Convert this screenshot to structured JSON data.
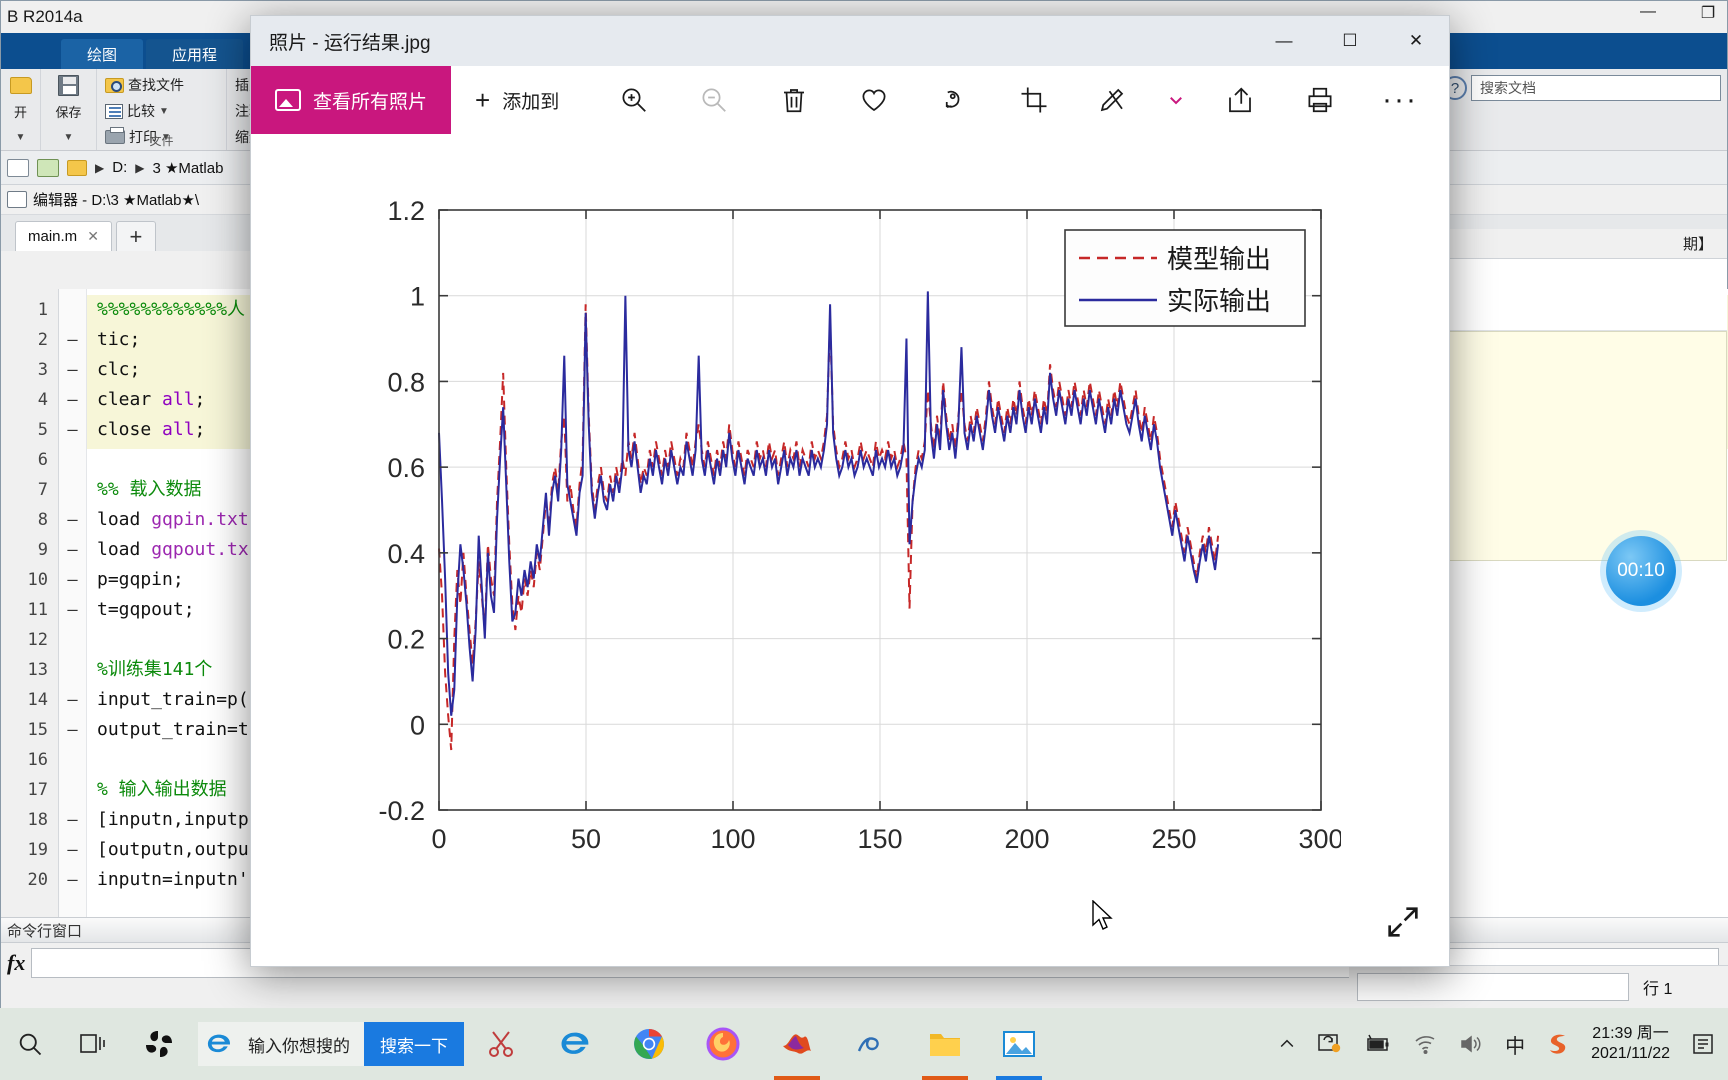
{
  "matlab": {
    "window_title": "B R2014a",
    "window_controls": [
      "—",
      "❐"
    ],
    "ribbon_tabs": [
      {
        "label": "绘图"
      },
      {
        "label": "应用程"
      }
    ],
    "ribbon": {
      "file_group_label": "文件",
      "open_label": "开",
      "save_label": "保存",
      "find_file_label": "查找文件",
      "compare_label": "比较",
      "print_label": "打印",
      "insert_label": "插入",
      "comment_label": "注释",
      "indent_label": "缩进",
      "help_search_placeholder": "搜索文档"
    },
    "address_bar": {
      "drive": "D:",
      "folder": "3 ★Matlab"
    },
    "editor_bar_label": "编辑器 - D:\\3 ★Matlab★\\",
    "tabs": [
      {
        "label": "main.m",
        "close": "✕"
      }
    ],
    "tab_add": "+",
    "code_lines": [
      {
        "n": "1",
        "mark": "",
        "parts": [
          {
            "t": "%%%%%%%%%%%%人",
            "c": "cm"
          }
        ]
      },
      {
        "n": "2",
        "mark": "—",
        "parts": [
          {
            "t": "tic;",
            "c": ""
          }
        ]
      },
      {
        "n": "3",
        "mark": "—",
        "parts": [
          {
            "t": "clc;",
            "c": ""
          }
        ]
      },
      {
        "n": "4",
        "mark": "—",
        "parts": [
          {
            "t": "clear ",
            "c": ""
          },
          {
            "t": "all",
            "c": "kw"
          },
          {
            "t": ";",
            "c": ""
          }
        ]
      },
      {
        "n": "5",
        "mark": "—",
        "parts": [
          {
            "t": "close ",
            "c": ""
          },
          {
            "t": "all",
            "c": "kw"
          },
          {
            "t": ";",
            "c": ""
          }
        ]
      },
      {
        "n": "6",
        "mark": "",
        "parts": []
      },
      {
        "n": "7",
        "mark": "",
        "parts": [
          {
            "t": "%% 载入数据",
            "c": "cm"
          }
        ]
      },
      {
        "n": "8",
        "mark": "—",
        "parts": [
          {
            "t": "load ",
            "c": ""
          },
          {
            "t": "gqpin.txt",
            "c": "st"
          }
        ]
      },
      {
        "n": "9",
        "mark": "—",
        "parts": [
          {
            "t": "load ",
            "c": ""
          },
          {
            "t": "gqpout.tx",
            "c": "st"
          }
        ]
      },
      {
        "n": "10",
        "mark": "—",
        "parts": [
          {
            "t": "p=gqpin;",
            "c": ""
          }
        ]
      },
      {
        "n": "11",
        "mark": "—",
        "parts": [
          {
            "t": "t=gqpout;",
            "c": ""
          }
        ]
      },
      {
        "n": "12",
        "mark": "",
        "parts": []
      },
      {
        "n": "13",
        "mark": "",
        "parts": [
          {
            "t": "%训练集141个",
            "c": "cm"
          }
        ]
      },
      {
        "n": "14",
        "mark": "—",
        "parts": [
          {
            "t": "input_train=p(",
            "c": ""
          }
        ]
      },
      {
        "n": "15",
        "mark": "—",
        "parts": [
          {
            "t": "output_train=t",
            "c": ""
          }
        ]
      },
      {
        "n": "16",
        "mark": "",
        "parts": []
      },
      {
        "n": "17",
        "mark": "",
        "parts": [
          {
            "t": "% 输入输出数据",
            "c": "cm"
          }
        ]
      },
      {
        "n": "18",
        "mark": "—",
        "parts": [
          {
            "t": "[inputn,inputp",
            "c": ""
          }
        ]
      },
      {
        "n": "19",
        "mark": "—",
        "parts": [
          {
            "t": "[outputn,outpu",
            "c": ""
          }
        ]
      },
      {
        "n": "20",
        "mark": "—",
        "parts": [
          {
            "t": "inputn=inputn'",
            "c": ""
          }
        ]
      }
    ],
    "command_window_title": "命令行窗口",
    "right_panel_header": "期】",
    "timer_value": "00:10",
    "status_row_label": "行  1"
  },
  "photos": {
    "title": "照片 - 运行结果.jpg",
    "window_controls": {
      "minimize": "—",
      "maximize": "☐",
      "close": "✕"
    },
    "view_all_label": "查看所有照片",
    "add_to_label": "添加到",
    "tool_icons": [
      {
        "name": "zoom-in-icon"
      },
      {
        "name": "zoom-out-icon"
      },
      {
        "name": "delete-icon"
      },
      {
        "name": "favorite-icon"
      },
      {
        "name": "rotate-icon"
      },
      {
        "name": "crop-icon"
      }
    ],
    "right_icons": [
      {
        "name": "edit-create-icon"
      },
      {
        "name": "chevron-down-icon"
      },
      {
        "name": "share-icon"
      },
      {
        "name": "print-icon"
      },
      {
        "name": "more-icon"
      }
    ],
    "more_label": "···"
  },
  "chart_data": {
    "type": "line",
    "title": "",
    "xlabel": "",
    "ylabel": "",
    "xlim": [
      0,
      300
    ],
    "ylim": [
      -0.2,
      1.2
    ],
    "xticks": [
      0,
      50,
      100,
      150,
      200,
      250,
      300
    ],
    "yticks": [
      -0.2,
      0,
      0.2,
      0.4,
      0.6,
      0.8,
      1,
      1.2
    ],
    "ytick_labels": [
      "-0.2",
      "0",
      "0.2",
      "0.4",
      "0.6",
      "0.8",
      "1",
      "1.2"
    ],
    "xtick_labels": [
      "0",
      "50",
      "100",
      "150",
      "200",
      "250",
      "300"
    ],
    "grid": true,
    "legend_position": "upper right",
    "colors": {
      "model": "#c62828",
      "actual": "#2b2b9e"
    },
    "series": [
      {
        "name": "模型输出",
        "style": "dashed",
        "color": "#c62828",
        "values": [
          0.41,
          0.3,
          0.12,
          0.02,
          -0.06,
          0.2,
          0.36,
          0.28,
          0.4,
          0.3,
          0.22,
          0.14,
          0.24,
          0.38,
          0.3,
          0.22,
          0.42,
          0.34,
          0.3,
          0.52,
          0.66,
          0.82,
          0.6,
          0.42,
          0.28,
          0.22,
          0.3,
          0.26,
          0.34,
          0.3,
          0.36,
          0.32,
          0.4,
          0.36,
          0.44,
          0.52,
          0.46,
          0.56,
          0.6,
          0.54,
          0.66,
          0.72,
          0.52,
          0.56,
          0.5,
          0.46,
          0.56,
          0.62,
          0.98,
          0.72,
          0.56,
          0.5,
          0.56,
          0.6,
          0.54,
          0.52,
          0.58,
          0.54,
          0.6,
          0.56,
          0.62,
          0.58,
          0.66,
          0.62,
          0.68,
          0.62,
          0.56,
          0.6,
          0.58,
          0.64,
          0.6,
          0.66,
          0.62,
          0.58,
          0.64,
          0.6,
          0.66,
          0.62,
          0.58,
          0.62,
          0.6,
          0.68,
          0.64,
          0.6,
          0.66,
          0.7,
          0.64,
          0.6,
          0.66,
          0.62,
          0.58,
          0.64,
          0.6,
          0.66,
          0.62,
          0.7,
          0.64,
          0.6,
          0.66,
          0.62,
          0.58,
          0.64,
          0.62,
          0.6,
          0.66,
          0.62,
          0.64,
          0.6,
          0.66,
          0.62,
          0.64,
          0.58,
          0.62,
          0.66,
          0.6,
          0.64,
          0.62,
          0.66,
          0.6,
          0.64,
          0.62,
          0.6,
          0.66,
          0.62,
          0.64,
          0.62,
          0.66,
          0.72,
          0.94,
          0.7,
          0.64,
          0.6,
          0.62,
          0.66,
          0.62,
          0.64,
          0.6,
          0.62,
          0.66,
          0.62,
          0.64,
          0.62,
          0.6,
          0.66,
          0.62,
          0.64,
          0.62,
          0.66,
          0.62,
          0.64,
          0.6,
          0.62,
          0.66,
          0.62,
          0.27,
          0.52,
          0.6,
          0.64,
          0.62,
          0.66,
          0.78,
          0.7,
          0.64,
          0.72,
          0.66,
          0.8,
          0.72,
          0.66,
          0.7,
          0.64,
          0.72,
          0.78,
          0.7,
          0.66,
          0.72,
          0.68,
          0.74,
          0.7,
          0.66,
          0.72,
          0.8,
          0.74,
          0.7,
          0.76,
          0.72,
          0.68,
          0.74,
          0.7,
          0.76,
          0.72,
          0.8,
          0.74,
          0.7,
          0.76,
          0.72,
          0.78,
          0.74,
          0.7,
          0.76,
          0.72,
          0.84,
          0.78,
          0.74,
          0.8,
          0.76,
          0.72,
          0.78,
          0.74,
          0.8,
          0.76,
          0.72,
          0.78,
          0.74,
          0.8,
          0.76,
          0.72,
          0.78,
          0.74,
          0.7,
          0.76,
          0.72,
          0.78,
          0.74,
          0.8,
          0.76,
          0.72,
          0.7,
          0.74,
          0.78,
          0.72,
          0.68,
          0.74,
          0.7,
          0.66,
          0.72,
          0.68,
          0.62,
          0.58,
          0.54,
          0.5,
          0.46,
          0.52,
          0.48,
          0.44,
          0.4,
          0.46,
          0.42,
          0.38,
          0.34,
          0.4,
          0.44,
          0.4,
          0.46,
          0.42,
          0.38,
          0.44
        ]
      },
      {
        "name": "实际输出",
        "style": "solid",
        "color": "#2b2b9e",
        "values": [
          0.68,
          0.52,
          0.34,
          0.12,
          0.02,
          0.08,
          0.3,
          0.42,
          0.36,
          0.28,
          0.18,
          0.1,
          0.22,
          0.44,
          0.32,
          0.2,
          0.4,
          0.3,
          0.26,
          0.48,
          0.62,
          0.74,
          0.56,
          0.38,
          0.24,
          0.26,
          0.34,
          0.3,
          0.36,
          0.32,
          0.38,
          0.34,
          0.42,
          0.38,
          0.46,
          0.54,
          0.44,
          0.54,
          0.58,
          0.52,
          0.64,
          0.86,
          0.56,
          0.52,
          0.48,
          0.44,
          0.54,
          0.58,
          0.96,
          0.7,
          0.54,
          0.48,
          0.54,
          0.58,
          0.52,
          0.5,
          0.56,
          0.52,
          0.58,
          0.54,
          0.6,
          1.0,
          0.64,
          0.6,
          0.66,
          0.6,
          0.54,
          0.58,
          0.56,
          0.62,
          0.58,
          0.64,
          0.6,
          0.56,
          0.62,
          0.58,
          0.64,
          0.6,
          0.56,
          0.6,
          0.58,
          0.66,
          0.62,
          0.58,
          0.64,
          0.86,
          0.62,
          0.58,
          0.64,
          0.6,
          0.56,
          0.62,
          0.58,
          0.64,
          0.6,
          0.68,
          0.62,
          0.58,
          0.64,
          0.6,
          0.56,
          0.62,
          0.6,
          0.58,
          0.64,
          0.6,
          0.62,
          0.58,
          0.64,
          0.6,
          0.62,
          0.56,
          0.6,
          0.64,
          0.58,
          0.62,
          0.6,
          0.64,
          0.58,
          0.62,
          0.6,
          0.58,
          0.64,
          0.6,
          0.62,
          0.6,
          0.64,
          0.7,
          0.98,
          0.68,
          0.62,
          0.58,
          0.6,
          0.64,
          0.6,
          0.62,
          0.58,
          0.6,
          0.64,
          0.6,
          0.62,
          0.6,
          0.58,
          0.64,
          0.6,
          0.62,
          0.6,
          0.64,
          0.6,
          0.62,
          0.58,
          0.6,
          0.64,
          0.9,
          0.42,
          0.52,
          0.58,
          0.62,
          0.6,
          0.64,
          1.01,
          0.68,
          0.62,
          0.7,
          0.64,
          0.78,
          0.7,
          0.64,
          0.68,
          0.62,
          0.7,
          0.88,
          0.68,
          0.64,
          0.7,
          0.66,
          0.72,
          0.68,
          0.64,
          0.7,
          0.78,
          0.72,
          0.68,
          0.74,
          0.7,
          0.66,
          0.72,
          0.68,
          0.74,
          0.7,
          0.78,
          0.72,
          0.68,
          0.74,
          0.7,
          0.76,
          0.72,
          0.68,
          0.74,
          0.7,
          0.82,
          0.76,
          0.72,
          0.78,
          0.74,
          0.7,
          0.76,
          0.72,
          0.78,
          0.74,
          0.7,
          0.76,
          0.72,
          0.78,
          0.74,
          0.7,
          0.76,
          0.72,
          0.68,
          0.74,
          0.7,
          0.76,
          0.72,
          0.78,
          0.74,
          0.7,
          0.68,
          0.72,
          0.76,
          0.7,
          0.66,
          0.72,
          0.68,
          0.64,
          0.7,
          0.66,
          0.6,
          0.56,
          0.52,
          0.48,
          0.44,
          0.5,
          0.46,
          0.42,
          0.38,
          0.44,
          0.4,
          0.36,
          0.33,
          0.38,
          0.42,
          0.38,
          0.44,
          0.4,
          0.36,
          0.42
        ]
      }
    ]
  },
  "taskbar": {
    "search_icon": "search-icon",
    "taskview_icon": "task-view-icon",
    "search_placeholder": "输入你想搜的",
    "search_button": "搜索一下",
    "apps": [
      {
        "name": "sogou-app-icon"
      },
      {
        "name": "snipaste-app-icon"
      },
      {
        "name": "ie-browser-icon"
      },
      {
        "name": "chrome-browser-icon"
      },
      {
        "name": "firefox-browser-icon"
      },
      {
        "name": "matlab-app-icon"
      },
      {
        "name": "editplus-app-icon"
      },
      {
        "name": "file-explorer-icon"
      },
      {
        "name": "photos-app-icon"
      }
    ],
    "tray": {
      "expand": "^",
      "icons": [
        "onedrive-sync-icon",
        "battery-icon",
        "wifi-icon",
        "volume-icon",
        "ime-chinese-icon",
        "sogou-ime-icon"
      ],
      "ime_label": "中",
      "time": "21:39 周一",
      "date": "2021/11/22",
      "action_center": "notifications-icon"
    }
  }
}
